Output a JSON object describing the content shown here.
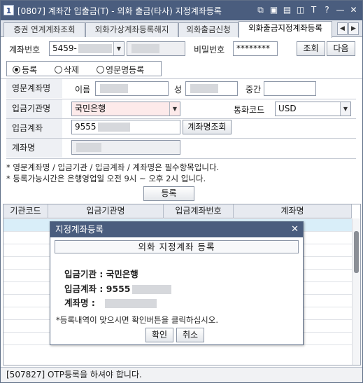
{
  "window": {
    "app_badge": "1",
    "title": "[0807] 계좌간 입출금(T) - 외화 출금(타사) 지정계좌등록",
    "controls": [
      "⧉",
      "▣",
      "▤",
      "◫",
      "T",
      "?",
      "—",
      "✕"
    ]
  },
  "tabs": [
    {
      "label": "증권 연계계좌조회",
      "active": false
    },
    {
      "label": "외화가상계좌등록해지",
      "active": false
    },
    {
      "label": "외화출금신청",
      "active": false
    },
    {
      "label": "외화출금지정계좌등록",
      "active": true
    }
  ],
  "tab_nav": {
    "prev": "◀",
    "next": "▶"
  },
  "account": {
    "account_label": "계좌번호",
    "account_value": "5459-",
    "password_label": "비밀번호",
    "password_value": "********",
    "query_button": "조회",
    "next_button": "다음"
  },
  "mode": {
    "options": [
      {
        "label": "등록",
        "selected": true
      },
      {
        "label": "삭제",
        "selected": false
      },
      {
        "label": "영문명등록",
        "selected": false
      }
    ]
  },
  "form": {
    "english_name_label": "영문계좌명",
    "first_name_label": "이름",
    "last_name_label": "성",
    "middle_name_label": "중간",
    "bank_label": "입금기관명",
    "bank_value": "국민은행",
    "currency_label": "통화코드",
    "currency_value": "USD",
    "deposit_account_label": "입금계좌",
    "deposit_account_value": "9555",
    "account_name_query_button": "계좌명조회",
    "account_name_label": "계좌명"
  },
  "notes": [
    "* 영문계좌명 / 입금기관 / 입금계좌 / 계좌명은 필수항목입니다.",
    "* 등록가능시간은 은행영업일 오전 9시 ~ 오후 2시 입니다."
  ],
  "register_button": "등록",
  "grid": {
    "columns": [
      "기관코드",
      "입금기관명",
      "입금계좌번호",
      "계좌명"
    ]
  },
  "status_bar": "[507827] OTP등록을 하셔야 합니다.",
  "dialog": {
    "title": "지정계좌등록",
    "close": "✕",
    "header": "외화 지정계좌 등록",
    "bank_line": "입금기관 : 국민은행",
    "account_line_label": "입금계좌 : 9555",
    "name_line_label": "계좌명 :",
    "note": "*등록내역이 맞으시면 확인버튼을 클릭하십시오.",
    "confirm_button": "확인",
    "cancel_button": "취소"
  }
}
